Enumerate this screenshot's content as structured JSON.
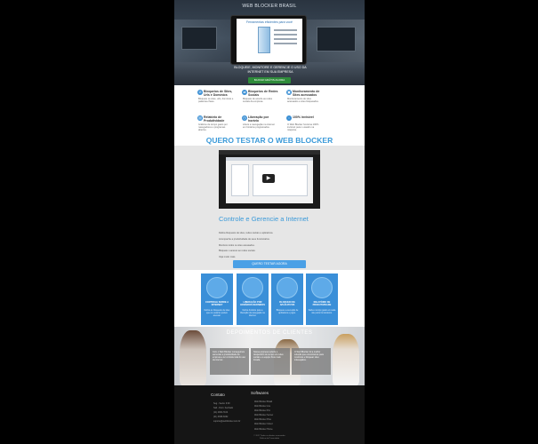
{
  "hero": {
    "topline": "WEB BLOCKER BRASIL",
    "tablet_title": "Ferramentas eficientes para você",
    "headline": "BLOQUEIE, MONITORE E GERENCIE O USO DA INTERNET EM SUA EMPRESA",
    "cta_label": "BAIXAR GRÁTIS AGORA"
  },
  "features": [
    {
      "icon": "block-icon",
      "glyph": "⊘",
      "title": "Bloqueios de Sites, Urls e Domínios",
      "desc": "Bloqueie os sites, urls, domínios e palavras-chave."
    },
    {
      "icon": "share-icon",
      "glyph": "⇄",
      "title": "Bloqueios de Redes Sociais",
      "desc": "Bloqueie de acordo as redes sociais da empresa."
    },
    {
      "icon": "monitor-icon",
      "glyph": "▣",
      "title": "Monitoramento de Sites acessados",
      "desc": "Monitoramento de sites acessados e sites bloqueados."
    },
    {
      "icon": "chart-icon",
      "glyph": "▤",
      "title": "Relatório de Produtividade",
      "desc": "Gráficos de tempo gasto por navegadores e programas abertos."
    },
    {
      "icon": "clock-icon",
      "glyph": "◷",
      "title": "Liberação por horário",
      "desc": "Libere a navegação na internet em horários programados."
    },
    {
      "icon": "invisible-icon",
      "glyph": "◌",
      "title": "100% invisível",
      "desc": "O Web Blocker funciona 100% invisível para o usuário na máquina."
    }
  ],
  "quero_title": "QUERO TESTAR O WEB BLOCKER",
  "video": {
    "play_icon": "play-icon",
    "play_glyph": "▶"
  },
  "manage": {
    "sub_a": "Controle e ",
    "sub_b": "Gerencie a Internet",
    "paragraphs": [
      "Defina bloqueios de sites, redes sociais e aplicativos.",
      "Acompanhe a produtividade de seus funcionários.",
      "Monitore todos os sites acessados.",
      "Bloqueie o acesso ao redes sociais.",
      "Veja muito mais."
    ],
    "cta_label": "QUERO TESTAR AGORA"
  },
  "cards": [
    {
      "icon": "globe-icon",
      "glyph": "🌐",
      "title": "CONTROLE SOBRE A INTERNET",
      "desc": "Defina os bloqueios de sites que os usuários podem acessar."
    },
    {
      "icon": "lock-icon",
      "glyph": "🔒",
      "title": "LIBERAÇÃO POR HORÁRIOS DEFINIDOS",
      "desc": "Defina horários para a liberação da navegação na internet."
    },
    {
      "icon": "apps-icon",
      "glyph": "▦",
      "title": "BLOQUEIO DE APLICATIVOS",
      "desc": "Bloqueie a execução de aplicativos e jogos."
    },
    {
      "icon": "report-icon",
      "glyph": "📈",
      "title": "RELATÓRIO DE PRODUTIVIDADE",
      "desc": "Saiba o tempo gasto em cada site pelos funcionários."
    }
  ],
  "testimonials": {
    "heading": "DEPOIMENTOS DE CLIENTES",
    "items": [
      "Com o Web Blocker conseguimos aumentar a produtividade da empresa e ter controle total do uso da internet.",
      "Nossa empresa reduziu o desperdício de tempo em redes sociais e a equipe ficou mais focada.",
      "O Web Blocker foi a melhor solução que encontramos para monitorar e bloquear sites indesejados."
    ]
  },
  "footer": {
    "contact_title": "Contato",
    "software_title": "Softwares",
    "contacts": [
      "Seg - Sexta: 9:00",
      "Sab - Dom: Fechado",
      "(11) 4063-7164",
      "(21) 3995-6062",
      "suporte@webblocker.com.br"
    ],
    "softwares": [
      "Web Blocker Brasil",
      "Web Blocker Lite",
      "Web Blocker Pro",
      "Web Blocker Server",
      "Web Blocker Plus",
      "Web Blocker Cloud",
      "Web Blocker Home"
    ],
    "copyright_a": "© 2017 Todos os direitos reservados",
    "copyright_b": "Política de Privacidade"
  }
}
